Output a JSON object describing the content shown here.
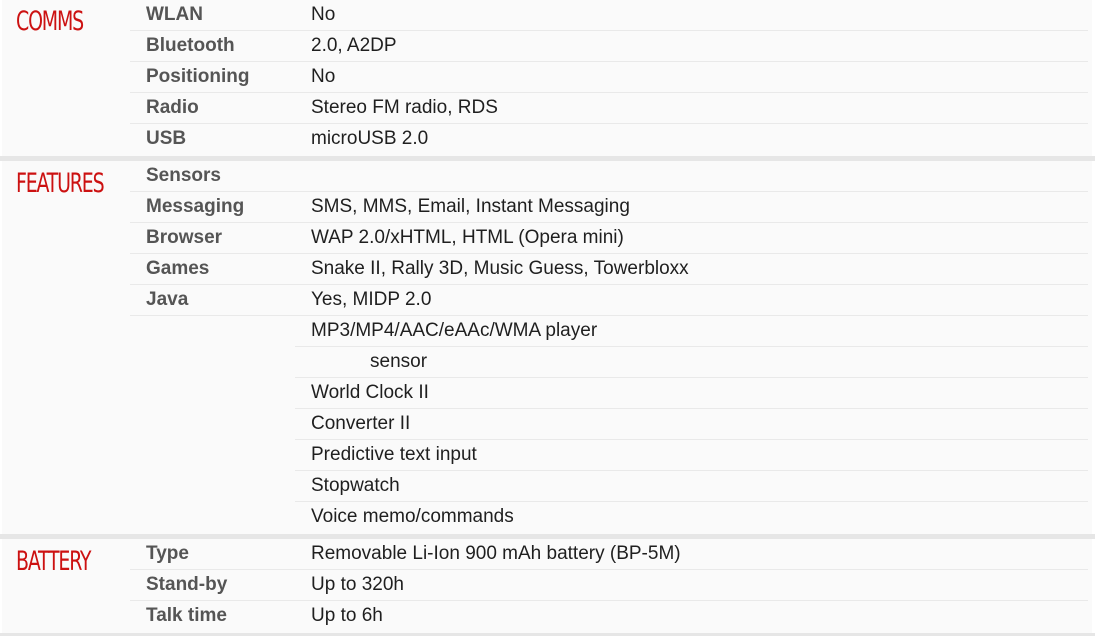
{
  "sections": [
    {
      "title": "COMMS",
      "rows": [
        {
          "label": "WLAN",
          "value": "No"
        },
        {
          "label": "Bluetooth",
          "value": "2.0, A2DP"
        },
        {
          "label": "Positioning",
          "value": "No"
        },
        {
          "label": "Radio",
          "value": "Stereo FM radio, RDS"
        },
        {
          "label": "USB",
          "value": "microUSB 2.0"
        }
      ]
    },
    {
      "title": "FEATURES",
      "rows": [
        {
          "label": "Sensors",
          "value": ""
        },
        {
          "label": "Messaging",
          "value": "SMS, MMS, Email, Instant Messaging"
        },
        {
          "label": "Browser",
          "value": "WAP 2.0/xHTML, HTML (Opera mini)"
        },
        {
          "label": "Games",
          "value": "Snake II, Rally 3D, Music Guess, Towerbloxx"
        },
        {
          "label": "Java",
          "value": "Yes, MIDP 2.0"
        }
      ],
      "extra_values": [
        "MP3/MP4/AAC/eAAc/WMA player",
        "sensor",
        "World Clock II",
        "Converter II",
        "Predictive text input",
        "Stopwatch",
        "Voice memo/commands"
      ]
    },
    {
      "title": "BATTERY",
      "rows": [
        {
          "label": "Type",
          "value": "Removable Li-Ion 900 mAh battery (BP-5M)"
        },
        {
          "label": "Stand-by",
          "value": "Up to 320h"
        },
        {
          "label": "Talk time",
          "value": "Up to 6h"
        }
      ]
    }
  ],
  "colors": {
    "section_title": "#cc1111",
    "label": "#555555",
    "value": "#1f1f1f",
    "separator": "#e6e6e6",
    "section_bg": "#fafafa"
  }
}
